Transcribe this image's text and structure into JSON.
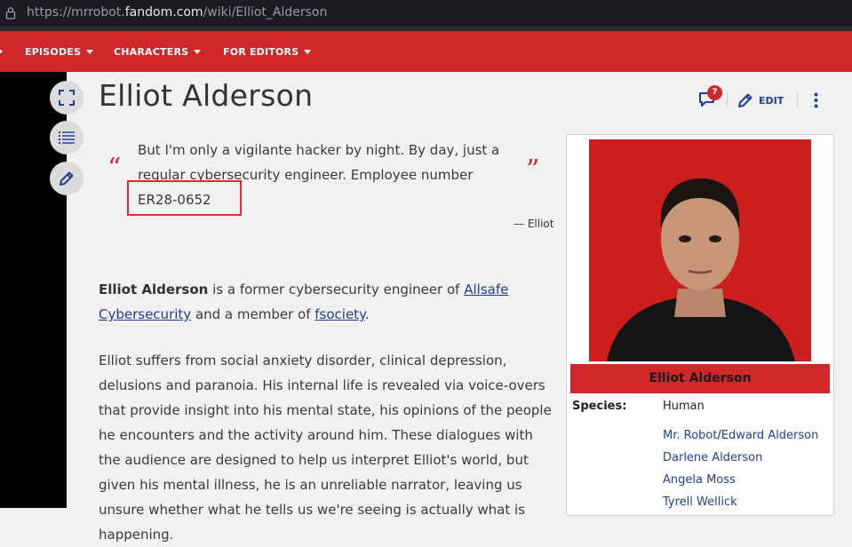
{
  "browser": {
    "url_scheme": "https://mrrobot.",
    "url_host": "fandom.com",
    "url_path": "/wiki/Elliot_Alderson"
  },
  "nav": {
    "items": [
      {
        "label": "EPISODES"
      },
      {
        "label": "CHARACTERS"
      },
      {
        "label": "FOR EDITORS"
      }
    ]
  },
  "toolbar": {
    "comment_count": "7",
    "edit_label": "EDIT"
  },
  "page": {
    "title": "Elliot Alderson"
  },
  "quote": {
    "open_mark": "“",
    "close_mark": "”",
    "text": "But I'm only a vigilante hacker by night. By day, just a regular cybersecurity engineer. Employee number ER28-0652",
    "attribution": "— Elliot"
  },
  "intro": {
    "name": "Elliot Alderson",
    "text1": " is a former cybersecurity engineer of ",
    "link1": "Allsafe Cybersecurity",
    "text2": " and a member of ",
    "link2": "fsociety",
    "text3": "."
  },
  "body": {
    "paragraph2": "Elliot suffers from social anxiety disorder, clinical depression, delusions and paranoia. His internal life is revealed via voice-overs that provide insight into his mental state, his opinions of the people he encounters and the activity around him. These dialogues with the audience are designed to help us interpret Elliot's world, but given his mental illness, he is an unreliable narrator, leaving us unsure whether what he tells us we're seeing is actually what is happening."
  },
  "infobox": {
    "title": "Elliot Alderson",
    "species_label": "Species:",
    "species_value": "Human",
    "relatives": {
      "link_a": "Mr. Robot",
      "sep": "/",
      "link_b": "Edward Alderson",
      "link_c": "Darlene Alderson",
      "link_d": "Angela Moss",
      "link_e": "Tyrell Wellick"
    }
  },
  "colors": {
    "accent": "#d0282a",
    "link": "#1f3f9b",
    "page_bg": "#f1f1f1"
  }
}
